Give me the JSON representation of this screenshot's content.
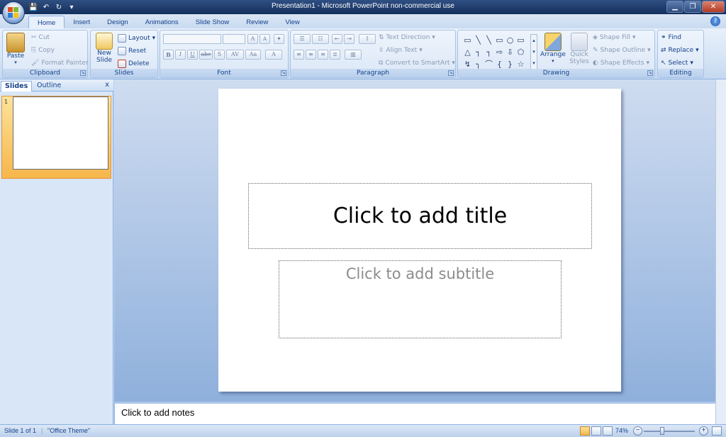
{
  "window": {
    "title": "Presentation1 - Microsoft PowerPoint non-commercial use"
  },
  "qat": {
    "icons": [
      "save-icon",
      "undo-icon",
      "redo-icon",
      "customize-icon"
    ]
  },
  "tabs": [
    "Home",
    "Insert",
    "Design",
    "Animations",
    "Slide Show",
    "Review",
    "View"
  ],
  "active_tab": "Home",
  "ribbon": {
    "clipboard": {
      "label": "Clipboard",
      "paste": "Paste",
      "cut": "Cut",
      "copy": "Copy",
      "format_painter": "Format Painter"
    },
    "slides": {
      "label": "Slides",
      "new_slide": "New Slide",
      "layout": "Layout",
      "reset": "Reset",
      "delete": "Delete"
    },
    "font": {
      "label": "Font",
      "bold": "B",
      "italic": "I",
      "underline": "U",
      "strike": "abe",
      "shadow": "S",
      "spacing": "AV",
      "case": "Aa",
      "grow": "A",
      "shrink": "A",
      "clear": "A"
    },
    "paragraph": {
      "label": "Paragraph",
      "text_direction": "Text Direction",
      "align_text": "Align Text",
      "convert_smartart": "Convert to SmartArt"
    },
    "drawing": {
      "label": "Drawing",
      "arrange": "Arrange",
      "quick_styles": "Quick Styles",
      "shape_fill": "Shape Fill",
      "shape_outline": "Shape Outline",
      "shape_effects": "Shape Effects",
      "shapes": [
        "▭",
        "╲",
        "╲",
        "▭",
        "○",
        "▭",
        "△",
        "┐",
        "┐",
        "⇨",
        "⇩",
        "⬠",
        "↯",
        "╮",
        "⌒",
        "{",
        "}",
        "☆"
      ]
    },
    "editing": {
      "label": "Editing",
      "find": "Find",
      "replace": "Replace",
      "select": "Select"
    }
  },
  "left_pane": {
    "tabs": [
      "Slides",
      "Outline"
    ],
    "close": "x",
    "slide_number": "1"
  },
  "slide": {
    "title_placeholder": "Click to add title",
    "subtitle_placeholder": "Click to add subtitle"
  },
  "notes": {
    "placeholder": "Click to add notes"
  },
  "status": {
    "slide_info": "Slide 1 of 1",
    "theme": "\"Office Theme\"",
    "zoom": "74%"
  }
}
